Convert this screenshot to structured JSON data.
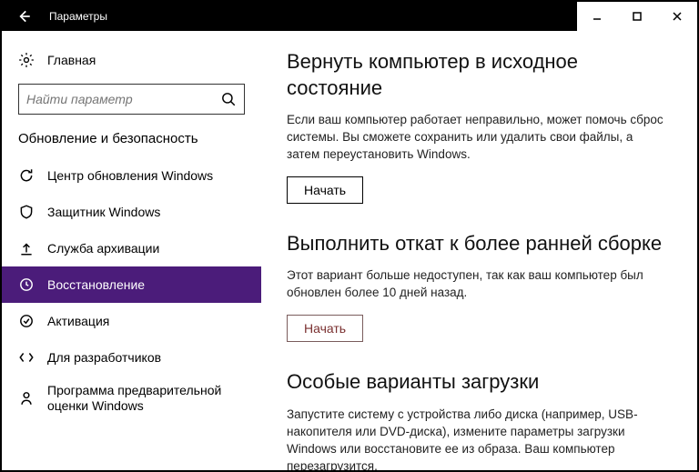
{
  "titlebar": {
    "title": "Параметры"
  },
  "sidebar": {
    "home": "Главная",
    "search_placeholder": "Найти параметр",
    "category": "Обновление и безопасность",
    "items": [
      {
        "label": "Центр обновления Windows"
      },
      {
        "label": "Защитник Windows"
      },
      {
        "label": "Служба архивации"
      },
      {
        "label": "Восстановление"
      },
      {
        "label": "Активация"
      },
      {
        "label": "Для разработчиков"
      },
      {
        "label": "Программа предварительной оценки Windows"
      }
    ]
  },
  "main": {
    "sections": [
      {
        "title": "Вернуть компьютер в исходное состояние",
        "desc": "Если ваш компьютер работает неправильно, может помочь сброс системы. Вы сможете сохранить или удалить свои файлы, а затем переустановить Windows.",
        "button": "Начать"
      },
      {
        "title": "Выполнить откат к более ранней сборке",
        "desc": "Этот вариант больше недоступен, так как ваш компьютер был обновлен более 10 дней назад.",
        "button": "Начать"
      },
      {
        "title": "Особые варианты загрузки",
        "desc": "Запустите систему с устройства либо диска (например, USB-накопителя или DVD-диска), измените параметры загрузки Windows или восстановите ее из образа. Ваш компьютер перезагрузится."
      }
    ]
  }
}
